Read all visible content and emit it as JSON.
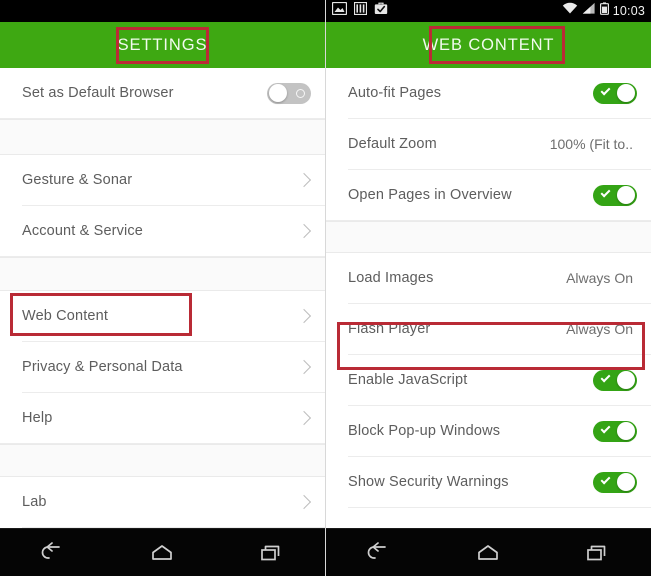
{
  "left_screen": {
    "statusbar": {
      "icons": [],
      "visible": false
    },
    "header": {
      "title": "SETTINGS",
      "highlighted": true
    },
    "rows": [
      {
        "label": "Set as Default Browser",
        "control": "toggle-off"
      },
      {
        "label": "Gesture & Sonar",
        "control": "chevron"
      },
      {
        "label": "Account & Service",
        "control": "chevron"
      },
      {
        "label": "Web Content",
        "control": "chevron",
        "highlighted": true
      },
      {
        "label": "Privacy & Personal Data",
        "control": "chevron"
      },
      {
        "label": "Help",
        "control": "chevron"
      },
      {
        "label": "Lab",
        "control": "chevron"
      }
    ]
  },
  "right_screen": {
    "statusbar": {
      "visible": true,
      "left_icons": [
        "image-icon",
        "bars-icon",
        "briefcase-check-icon"
      ],
      "right_icons": [
        "wifi-icon",
        "signal-icon",
        "battery-icon"
      ],
      "clock": "10:03"
    },
    "header": {
      "title": "WEB CONTENT",
      "highlighted": true
    },
    "rows": [
      {
        "label": "Auto-fit Pages",
        "control": "toggle-on"
      },
      {
        "label": "Default Zoom",
        "control": "value",
        "value": "100% (Fit to.."
      },
      {
        "label": "Open Pages in Overview",
        "control": "toggle-on"
      },
      {
        "label": "Load Images",
        "control": "value",
        "value": "Always On"
      },
      {
        "label": "Flash Player",
        "control": "value",
        "value": "Always On",
        "highlighted": true
      },
      {
        "label": "Enable JavaScript",
        "control": "toggle-on"
      },
      {
        "label": "Block Pop-up Windows",
        "control": "toggle-on"
      },
      {
        "label": "Show Security Warnings",
        "control": "toggle-on"
      }
    ]
  },
  "navbar": {
    "buttons": [
      {
        "name": "back-icon",
        "label": "Back"
      },
      {
        "name": "home-icon",
        "label": "Home"
      },
      {
        "name": "recents-icon",
        "label": "Recent apps"
      }
    ]
  },
  "colors": {
    "header_green": "#3ea812",
    "toggle_on_green": "#34a415",
    "highlight_red": "#b92a35",
    "text_gray": "#5d5d5d",
    "navbar_black": "#050505"
  }
}
